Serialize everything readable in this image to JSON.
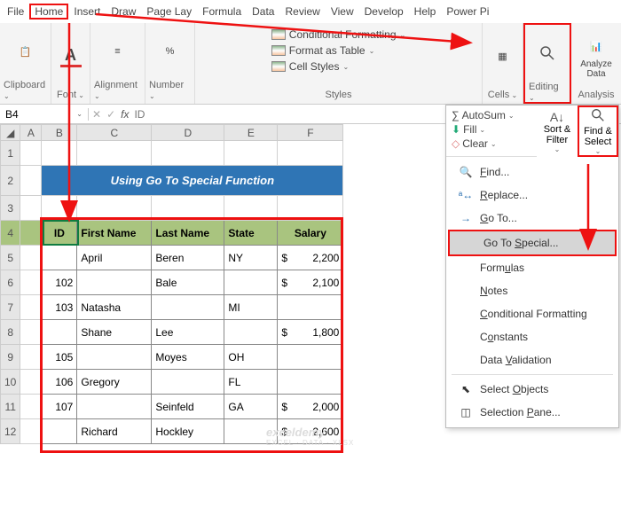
{
  "menubar": [
    "File",
    "Home",
    "Insert",
    "Draw",
    "Page Lay",
    "Formula",
    "Data",
    "Review",
    "View",
    "Develop",
    "Help",
    "Power Pi"
  ],
  "ribbon": {
    "clipboard": "Clipboard",
    "font": "Font",
    "alignment": "Alignment",
    "number": "Number",
    "styles": "Styles",
    "cond_fmt": "Conditional Formatting",
    "fmt_table": "Format as Table",
    "cell_styles": "Cell Styles",
    "cells": "Cells",
    "editing": "Editing",
    "analyze": "Analyze Data",
    "analysis": "Analysis"
  },
  "namebox": {
    "ref": "B4",
    "formula": "ID"
  },
  "columns": [
    "A",
    "B",
    "C",
    "D",
    "E",
    "F"
  ],
  "rows": [
    "1",
    "2",
    "3",
    "4",
    "5",
    "6",
    "7",
    "8",
    "9",
    "10",
    "11",
    "12"
  ],
  "title": "Using Go To Special Function",
  "table": {
    "headers": [
      "ID",
      "First Name",
      "Last Name",
      "State",
      "Salary"
    ],
    "rows": [
      {
        "id": "",
        "first": "April",
        "last": "Beren",
        "state": "NY",
        "salary": "2,200"
      },
      {
        "id": "102",
        "first": "",
        "last": "Bale",
        "state": "",
        "salary": "2,100"
      },
      {
        "id": "103",
        "first": "Natasha",
        "last": "",
        "state": "MI",
        "salary": ""
      },
      {
        "id": "",
        "first": "Shane",
        "last": "Lee",
        "state": "",
        "salary": "1,800"
      },
      {
        "id": "105",
        "first": "",
        "last": "Moyes",
        "state": "OH",
        "salary": ""
      },
      {
        "id": "106",
        "first": "Gregory",
        "last": "",
        "state": "FL",
        "salary": ""
      },
      {
        "id": "107",
        "first": "",
        "last": "Seinfeld",
        "state": "GA",
        "salary": "2,000"
      },
      {
        "id": "",
        "first": "Richard",
        "last": "Hockley",
        "state": "",
        "salary": "2,600"
      }
    ]
  },
  "mini": {
    "autosum": "AutoSum",
    "fill": "Fill",
    "clear": "Clear",
    "sort": "Sort & Filter",
    "find": "Find & Select"
  },
  "menu": {
    "find": "Find...",
    "replace": "Replace...",
    "goto": "Go To...",
    "special": "Go To Special...",
    "formulas": "Formulas",
    "notes": "Notes",
    "cond": "Conditional Formatting",
    "constants": "Constants",
    "dv": "Data Validation",
    "selobj": "Select Objects",
    "selpane": "Selection Pane..."
  },
  "watermark": {
    "main": "exceldemy",
    "sub": "EXCEL · DATA · XLSX"
  }
}
